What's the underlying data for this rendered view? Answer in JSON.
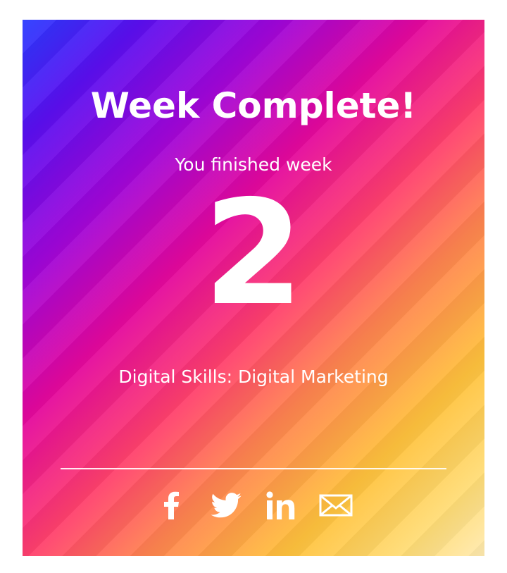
{
  "card": {
    "title": "Week Complete!",
    "subtitle": "You finished week",
    "week_number": "2",
    "course_name": "Digital Skills: Digital Marketing"
  },
  "share": {
    "buttons": [
      {
        "icon": "facebook-icon"
      },
      {
        "icon": "twitter-icon"
      },
      {
        "icon": "linkedin-icon"
      },
      {
        "icon": "email-icon"
      }
    ]
  },
  "colors": {
    "text": "#ffffff",
    "gradient_start": "#2a3bff",
    "gradient_mid": "#e3079e",
    "gradient_end": "#ffeab0"
  }
}
